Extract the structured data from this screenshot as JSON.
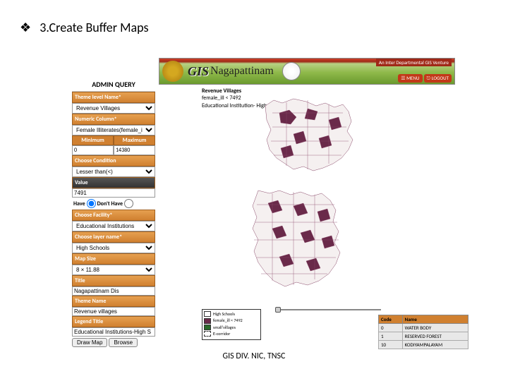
{
  "heading": "3.Create Buffer Maps",
  "bullet_symbol": "❖",
  "banner": {
    "gis_label": "GIS",
    "place_label": "Nagapattinam",
    "tagline": "An Inter Departmental GIS Venture",
    "menu_btn": "☰ MENU",
    "logout_btn": "⎋ LOGOUT"
  },
  "sidebar": {
    "title": "ADMIN QUERY",
    "labels": {
      "theme_layer": "Theme level Name*",
      "numeric_column": "Numeric Column*",
      "minimum": "Minimum",
      "maximum": "Maximum",
      "choose_condition": "Choose Condition",
      "value": "Value",
      "choose_facility": "Choose Facility*",
      "choose_layer": "Choose layer name*",
      "map_size": "Map Size",
      "title_label": "Title",
      "theme_name": "Theme Name",
      "legend_title": "Legend Title",
      "have": "Have",
      "dont_have": "Don't Have"
    },
    "values": {
      "theme_layer": "Revenue Villages",
      "numeric_column": "Female Illiterates(female_ill)",
      "minimum": "0",
      "maximum": "14380",
      "condition": "Lesser than(<)",
      "value_input": "7491",
      "facility": "Educational Institutions",
      "layer_name": "High Schools",
      "map_size": "8 × 11.88",
      "title": "Nagapattinam Dis",
      "theme_name": "Revenue villages",
      "legend_title": "Educational Institutions-High S"
    },
    "buttons": {
      "draw": "Draw Map",
      "browse": "Browse"
    }
  },
  "map_meta": {
    "line1_label": "Revenue Villages",
    "line2": "female_ill < 7492",
    "line3": "Educational Institution- High Schools"
  },
  "legend": {
    "rows": [
      {
        "color": "#ffffff",
        "label": "High Schools"
      },
      {
        "color": "#6a2a4a",
        "label": "female_ill < 7492"
      },
      {
        "color": "#2a6a2a",
        "label": "small'villages"
      },
      {
        "color": "#ffffff",
        "label": "E-corridor"
      }
    ]
  },
  "info_table": {
    "headers": {
      "code": "Code",
      "name": "Name"
    },
    "rows": [
      {
        "code": "0",
        "name": "WATER BODY"
      },
      {
        "code": "1",
        "name": "RESERVED FOREST"
      },
      {
        "code": "10",
        "name": "KODIYAMPALAYAM"
      }
    ]
  },
  "footer": "GIS DIV. NIC, TNSC"
}
